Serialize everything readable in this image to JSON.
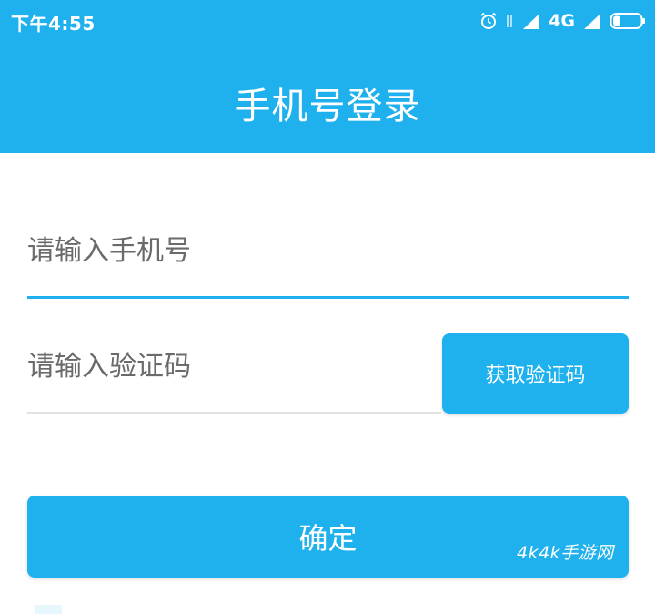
{
  "status_bar": {
    "time": "下午4:55",
    "network": "4G",
    "icons": [
      "alarm-icon",
      "data-arrows-icon",
      "signal-icon",
      "signal-icon",
      "battery-icon"
    ]
  },
  "header": {
    "title": "手机号登录"
  },
  "form": {
    "phone_placeholder": "请输入手机号",
    "code_placeholder": "请输入验证码",
    "get_code_label": "获取验证码",
    "confirm_label": "确定"
  },
  "watermark": "4k4k手游网",
  "colors": {
    "accent": "#1fb1ee",
    "background": "#ffffff",
    "placeholder": "#6a6a6a",
    "divider": "#e3e3e3"
  }
}
